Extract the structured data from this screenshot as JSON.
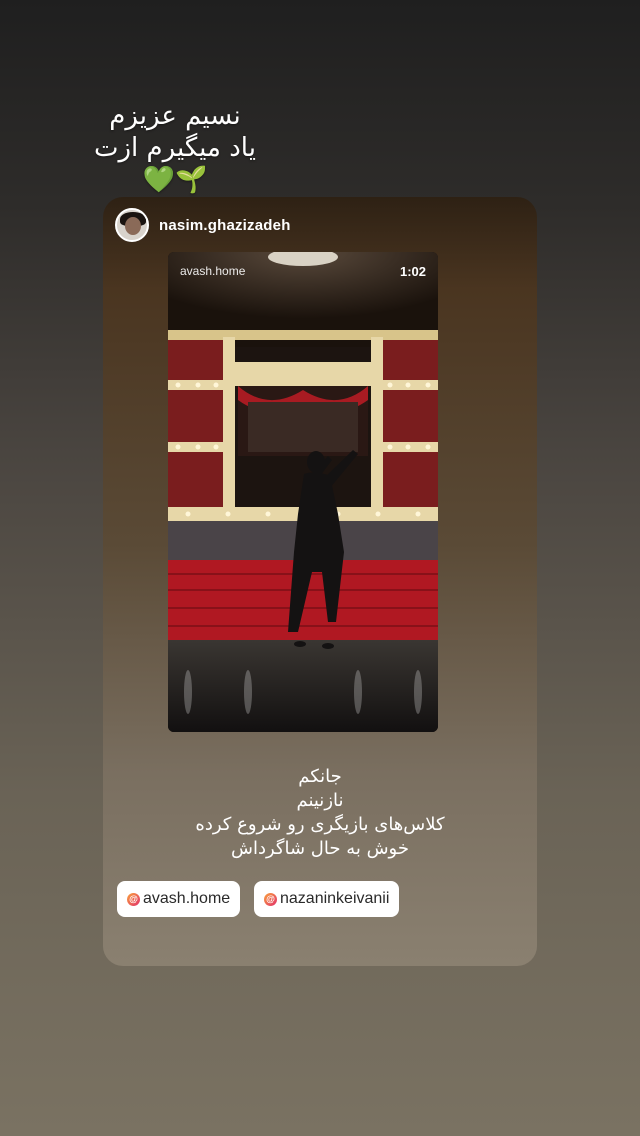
{
  "story_caption": {
    "line1": "نسیم عزیزم",
    "line2": "یاد میگیرم ازت",
    "emoji": "🌱💚"
  },
  "shared_post": {
    "author_username": "nasim.ghazizadeh",
    "post_username": "avash.home",
    "video_duration": "1:02",
    "caption_lines": [
      "جانکم",
      "نازنینم",
      "کلاس‌های بازیگری رو شروع کرده",
      "خوش به حال شاگرداش"
    ]
  },
  "mentions": [
    {
      "username": "avash.home"
    },
    {
      "username": "nazaninkeivanii"
    }
  ],
  "icons": {
    "mention_icon": "at-sign-icon"
  },
  "colors": {
    "seat_red": "#b01822",
    "theater_gold": "#e7d7a8",
    "mention_gradient": [
      "#f9a23c",
      "#e1306c"
    ]
  }
}
